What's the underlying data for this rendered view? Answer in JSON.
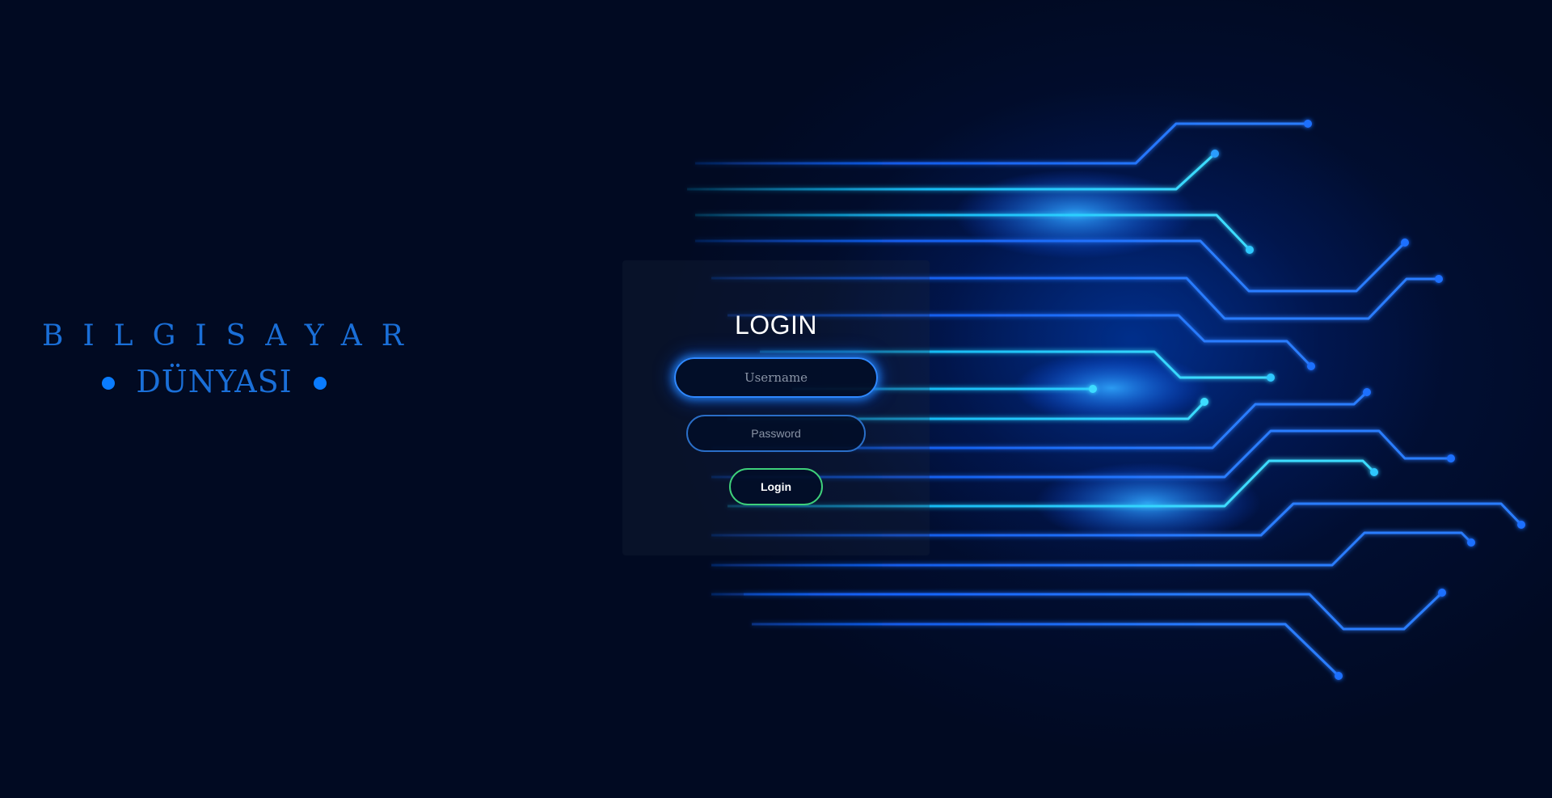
{
  "brand": {
    "line1": "BILGISAYAR",
    "line2": "DÜNYASI",
    "color": "#1a6fd8",
    "dot_color": "#0a7cff"
  },
  "login": {
    "title": "LOGIN",
    "username_placeholder": "Username",
    "password_placeholder": "Password",
    "button_label": "Login"
  },
  "theme": {
    "background": "#010a22",
    "circuit_color": "#1565ff",
    "circuit_highlight": "#18c6ff",
    "button_border": "#3ed07a"
  }
}
